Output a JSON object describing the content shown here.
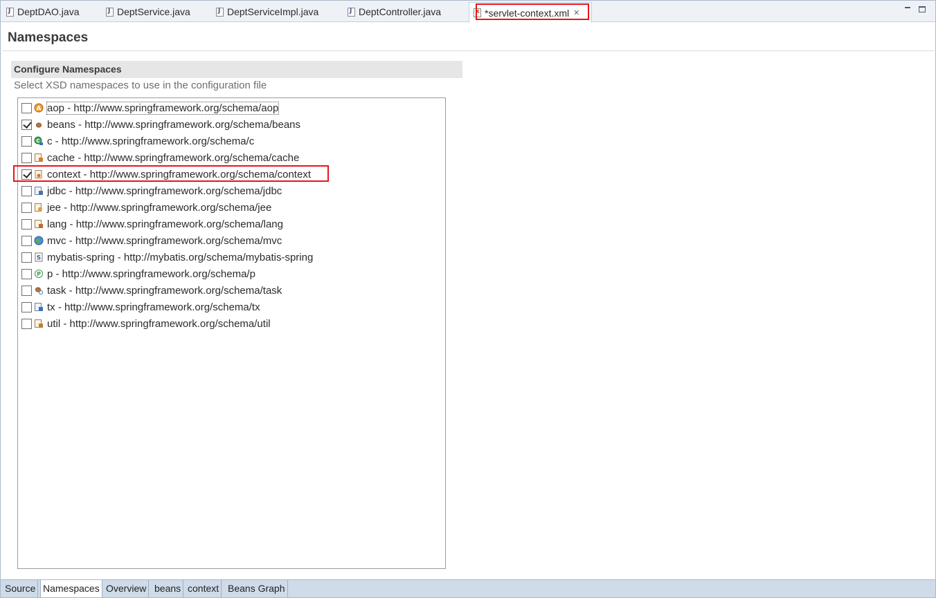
{
  "tabs": [
    {
      "label": "DeptDAO.java",
      "icon": "java-file-icon"
    },
    {
      "label": "DeptService.java",
      "icon": "java-file-icon"
    },
    {
      "label": "DeptServiceImpl.java",
      "icon": "java-file-icon"
    },
    {
      "label": "DeptController.java",
      "icon": "java-file-icon"
    },
    {
      "label": "*servlet-context.xml",
      "icon": "xml-file-icon",
      "active": true
    }
  ],
  "page": {
    "title": "Namespaces",
    "section_title": "Configure Namespaces",
    "section_desc": "Select XSD namespaces to use in the configuration file"
  },
  "namespaces": [
    {
      "label": "aop - http://www.springframework.org/schema/aop",
      "checked": false,
      "icon": "aop-icon"
    },
    {
      "label": "beans - http://www.springframework.org/schema/beans",
      "checked": true,
      "icon": "bean-icon"
    },
    {
      "label": "c - http://www.springframework.org/schema/c",
      "checked": false,
      "icon": "c-namespace-icon"
    },
    {
      "label": "cache - http://www.springframework.org/schema/cache",
      "checked": false,
      "icon": "cache-icon"
    },
    {
      "label": "context - http://www.springframework.org/schema/context",
      "checked": true,
      "icon": "context-icon"
    },
    {
      "label": "jdbc - http://www.springframework.org/schema/jdbc",
      "checked": false,
      "icon": "jdbc-icon"
    },
    {
      "label": "jee - http://www.springframework.org/schema/jee",
      "checked": false,
      "icon": "jee-icon"
    },
    {
      "label": "lang - http://www.springframework.org/schema/lang",
      "checked": false,
      "icon": "lang-icon"
    },
    {
      "label": "mvc - http://www.springframework.org/schema/mvc",
      "checked": false,
      "icon": "mvc-icon"
    },
    {
      "label": "mybatis-spring - http://mybatis.org/schema/mybatis-spring",
      "checked": false,
      "icon": "mybatis-icon"
    },
    {
      "label": "p - http://www.springframework.org/schema/p",
      "checked": false,
      "icon": "p-namespace-icon"
    },
    {
      "label": "task - http://www.springframework.org/schema/task",
      "checked": false,
      "icon": "task-icon"
    },
    {
      "label": "tx - http://www.springframework.org/schema/tx",
      "checked": false,
      "icon": "tx-icon"
    },
    {
      "label": "util - http://www.springframework.org/schema/util",
      "checked": false,
      "icon": "util-icon"
    }
  ],
  "page_tabs": [
    {
      "label": "Source"
    },
    {
      "label": "Namespaces",
      "active": true
    },
    {
      "label": "Overview"
    },
    {
      "label": "beans"
    },
    {
      "label": "context"
    },
    {
      "label": "Beans Graph"
    }
  ],
  "colors": {
    "highlight": "#e8141b",
    "tabbar": "#eef2f7",
    "pagetabs": "#cfdbe9"
  }
}
